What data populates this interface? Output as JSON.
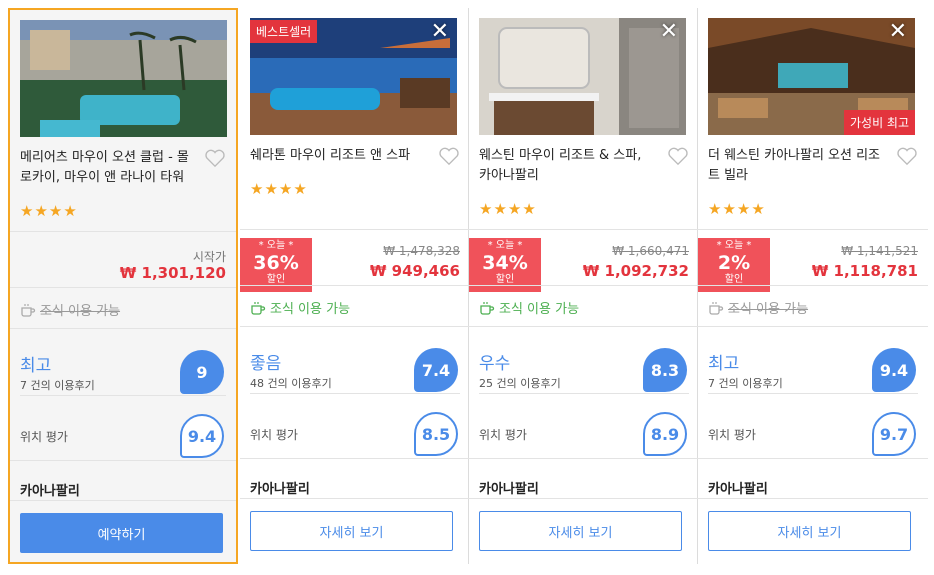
{
  "hotels": [
    {
      "name": "메리어츠 마우이 오션 클럽 - 몰로카이, 마우이 앤 라나이 타워",
      "stars": "★★★★",
      "price_label": "시작가",
      "price": "₩ 1,301,120",
      "breakfast": "조식 이용 가능",
      "rating_word": "최고",
      "review_count": "7 건의 이용후기",
      "score": "9",
      "location_label": "위치 평가",
      "location_score": "9.4",
      "area": "카아나팔리",
      "button": "예약하기"
    },
    {
      "name": "쉐라톤 마우이 리조트 앤 스파",
      "badge": "베스트셀러",
      "stars": "★★★★",
      "deal_today": "* 오늘 *",
      "deal_pct": "36%",
      "deal_off": "할인",
      "old_price": "₩ 1,478,328",
      "price": "₩ 949,466",
      "breakfast": "조식 이용 가능",
      "rating_word": "좋음",
      "review_count": "48 건의 이용후기",
      "score": "7.4",
      "location_label": "위치 평가",
      "location_score": "8.5",
      "area": "카아나팔리",
      "button": "자세히 보기"
    },
    {
      "name": "웨스틴 마우이 리조트 & 스파, 카아나팔리",
      "stars": "★★★★",
      "deal_today": "* 오늘 *",
      "deal_pct": "34%",
      "deal_off": "할인",
      "old_price": "₩ 1,660,471",
      "price": "₩ 1,092,732",
      "breakfast": "조식 이용 가능",
      "rating_word": "우수",
      "review_count": "25 건의 이용후기",
      "score": "8.3",
      "location_label": "위치 평가",
      "location_score": "8.9",
      "area": "카아나팔리",
      "button": "자세히 보기"
    },
    {
      "name": "더 웨스틴 카아나팔리 오션 리조트 빌라",
      "badge": "가성비 최고",
      "stars": "★★★★",
      "deal_today": "* 오늘 *",
      "deal_pct": "2%",
      "deal_off": "할인",
      "old_price": "₩ 1,141,521",
      "price": "₩ 1,118,781",
      "breakfast": "조식 이용 가능",
      "rating_word": "최고",
      "review_count": "7 건의 이용후기",
      "score": "9.4",
      "location_label": "위치 평가",
      "location_score": "9.7",
      "area": "카아나팔리",
      "button": "자세히 보기"
    }
  ],
  "icons": {
    "close": "close-icon",
    "heart": "heart-icon",
    "cup": "coffee-cup-icon"
  },
  "colors": {
    "accent": "#4a8be8",
    "price": "#e3343d",
    "selected_border": "#f5a623",
    "breakfast_ok": "#4caf50"
  }
}
